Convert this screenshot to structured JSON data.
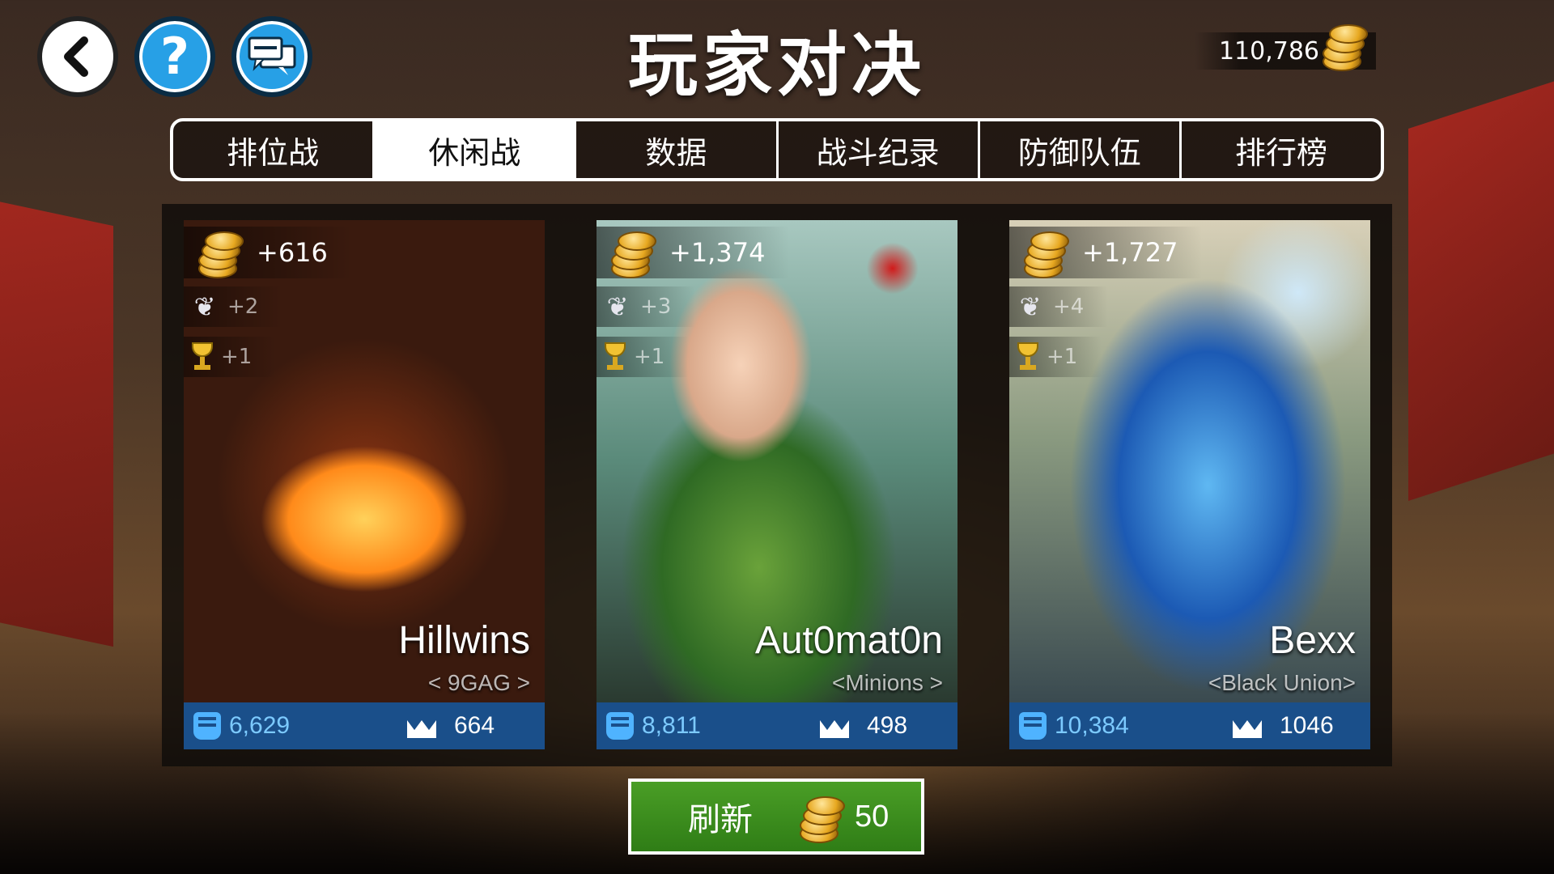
{
  "header": {
    "title": "玩家对决",
    "gold_balance": "110,786"
  },
  "icons": {
    "back": "back-arrow-icon",
    "help": "question-mark-icon",
    "chat": "chat-bubbles-icon",
    "gold": "gold-coins-icon",
    "wing": "wing-icon",
    "trophy": "trophy-icon",
    "power": "fist-icon",
    "rank": "crown-icon"
  },
  "tabs": [
    {
      "label": "排位战",
      "active": false
    },
    {
      "label": "休闲战",
      "active": true
    },
    {
      "label": "数据",
      "active": false
    },
    {
      "label": "战斗纪录",
      "active": false
    },
    {
      "label": "防御队伍",
      "active": false
    },
    {
      "label": "排行榜",
      "active": false
    }
  ],
  "opponents": [
    {
      "gold_reward": "+616",
      "wing_reward": "+2",
      "trophy_reward": "+1",
      "name": "Hillwins",
      "guild": "< 9GAG >",
      "power": "6,629",
      "rank": "664"
    },
    {
      "gold_reward": "+1,374",
      "wing_reward": "+3",
      "trophy_reward": "+1",
      "name": "Aut0mat0n",
      "guild": "<Minions >",
      "power": "8,811",
      "rank": "498"
    },
    {
      "gold_reward": "+1,727",
      "wing_reward": "+4",
      "trophy_reward": "+1",
      "name": "Bexx",
      "guild": "<Black Union>",
      "power": "10,384",
      "rank": "1046"
    }
  ],
  "refresh": {
    "label": "刷新",
    "cost": "50"
  },
  "colors": {
    "tab_active_bg": "#ffffff",
    "stats_bar": "#1a4f8a",
    "power_text": "#7ccaff",
    "refresh_button": "#3c8e1e",
    "accent_blue": "#27a0e6"
  }
}
